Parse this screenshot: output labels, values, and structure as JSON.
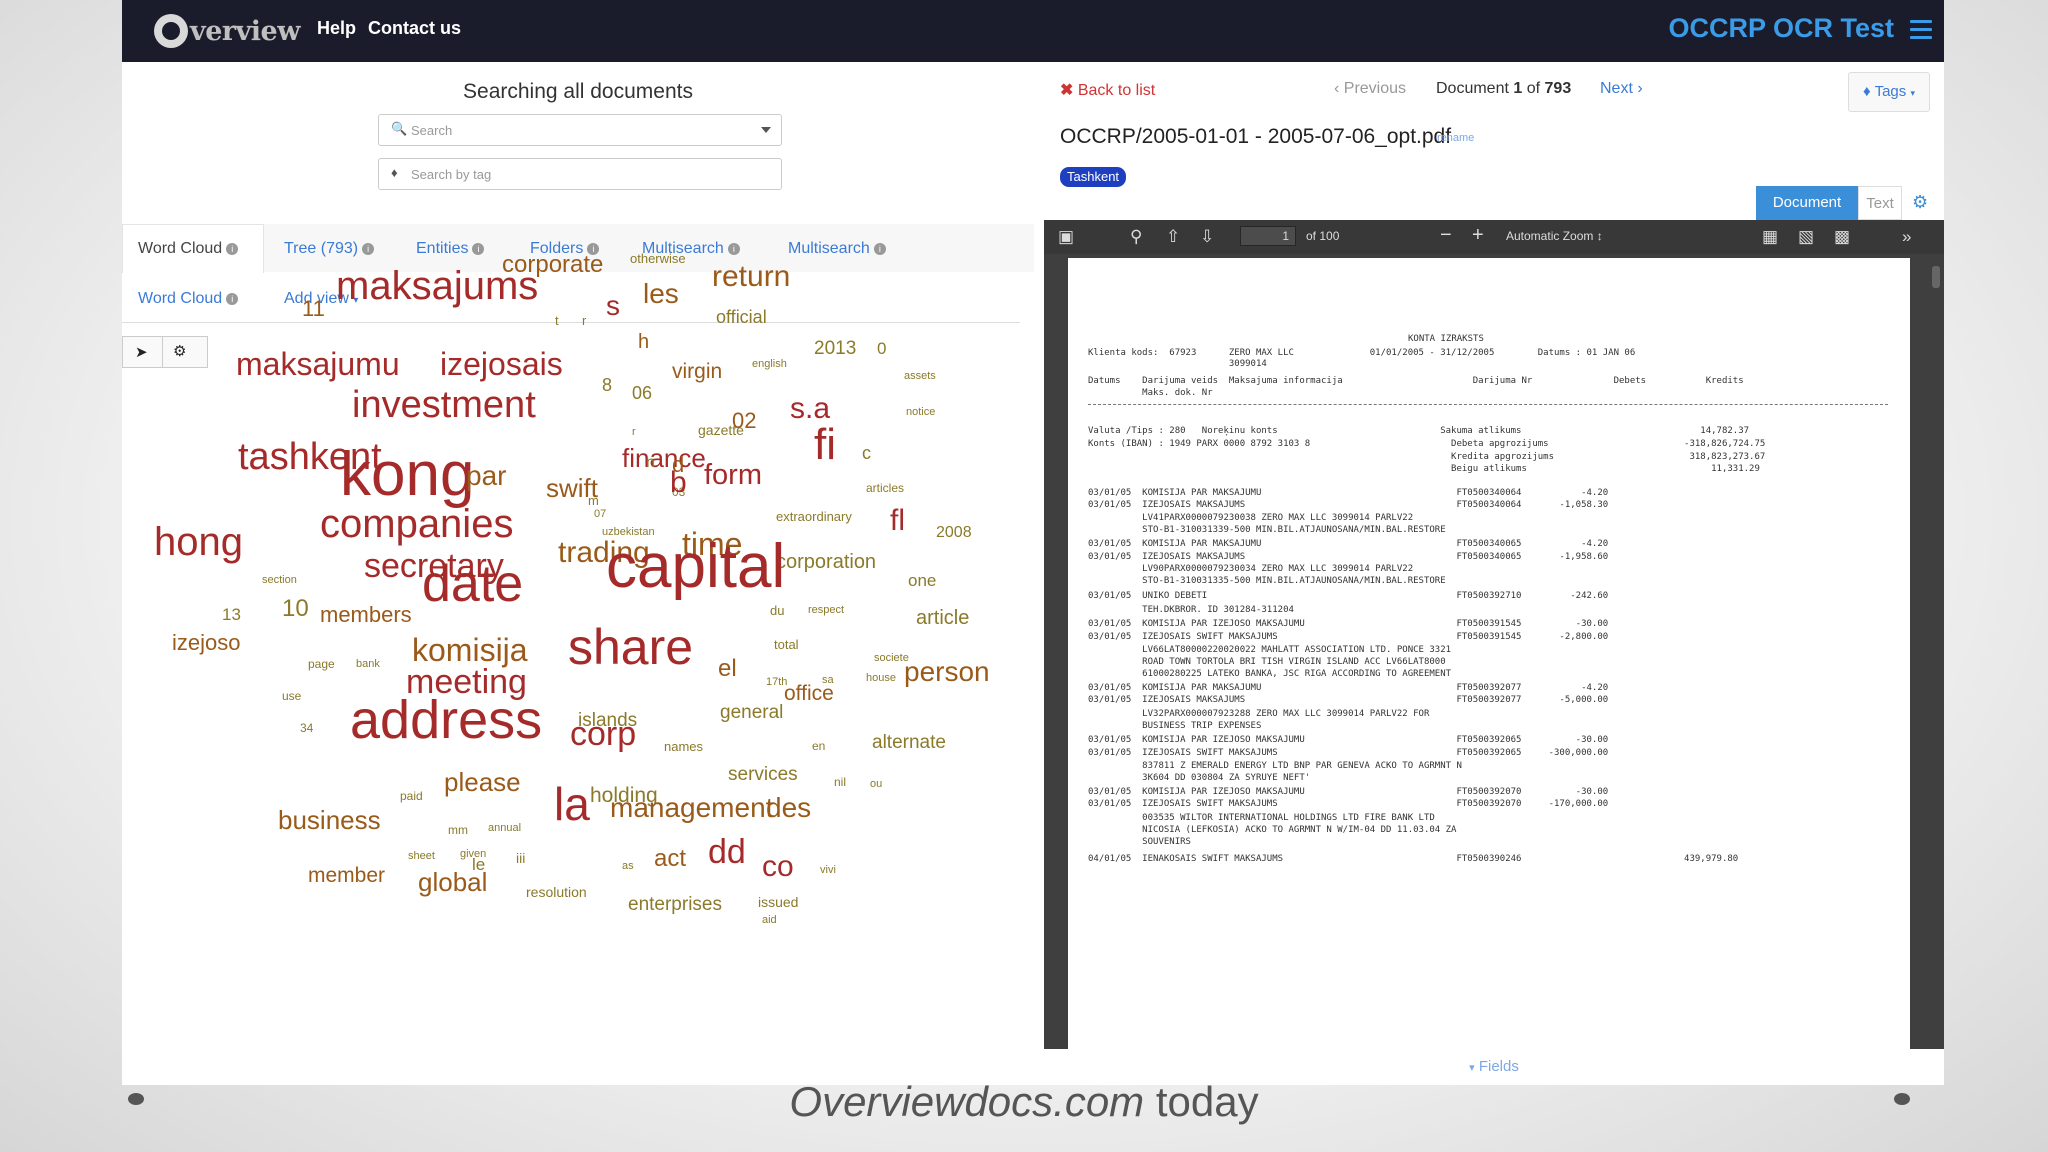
{
  "navbar": {
    "logo_text": "verview",
    "links": [
      "Help",
      "Contact us"
    ],
    "app_title": "OCCRP OCR Test",
    "menu_icon": "hamburger-icon"
  },
  "search": {
    "heading": "Searching all documents",
    "search_placeholder": "Search",
    "tag_placeholder": "Search by tag"
  },
  "views": {
    "tabs_row1": [
      {
        "label": "Word Cloud",
        "active": true
      },
      {
        "label": "Tree (793)",
        "active": false
      },
      {
        "label": "Entities",
        "active": false
      },
      {
        "label": "Folders",
        "active": false
      },
      {
        "label": "Multisearch",
        "active": false
      },
      {
        "label": "Multisearch",
        "active": false
      }
    ],
    "tabs_row2": [
      {
        "label": "Word Cloud"
      },
      {
        "label": "Add view"
      }
    ]
  },
  "word_cloud": {
    "colors": {
      "dark": "#a52a2a",
      "mid": "#9a5a1a",
      "light": "#8a7a2a"
    },
    "words": [
      "corporate",
      "otherwise",
      "return",
      "11",
      "maksajums",
      "t",
      "r",
      "les",
      "s",
      "official",
      "h",
      "maksajumu",
      "izejosais",
      "virgin",
      "english",
      "2013",
      "0",
      "assets",
      "investment",
      "8",
      "06",
      "r",
      "gazette",
      "02",
      "s.a",
      "notice",
      "finance",
      "n",
      "d",
      "03",
      "c",
      "tashkent",
      "kong",
      "par",
      "swift",
      "m",
      "uzbekistan",
      "b",
      "form",
      "fi",
      "articles",
      "07",
      "extraordinary",
      "fl",
      "2008",
      "hong",
      "companies",
      "trading",
      "time",
      "corporation",
      "section",
      "one",
      "secretary",
      "13",
      "10",
      "members",
      "date",
      "capital",
      "du",
      "respect",
      "article",
      "izejoso",
      "total",
      "societe",
      "page",
      "bank",
      "komisija",
      "sa",
      "house",
      "share",
      "el",
      "17th",
      "use",
      "meeting",
      "office",
      "person",
      "34",
      "islands",
      "general",
      "address",
      "names",
      "corp",
      "en",
      "alternate",
      "services",
      "nil",
      "ou",
      "paid",
      "please",
      "holding",
      "business",
      "mm",
      "annual",
      "la",
      "management",
      "des",
      "given",
      "sheet",
      "le",
      "iii",
      "as",
      "act",
      "dd",
      "co",
      "vivi",
      "member",
      "global",
      "resolution",
      "issued",
      "enterprises",
      "aid"
    ]
  },
  "document": {
    "back_label": "Back to list",
    "prev_label": "Previous",
    "position_prefix": "Document",
    "position_current": "1",
    "position_of": "of",
    "position_total": "793",
    "next_label": "Next",
    "tags_label": "Tags",
    "title": "OCCRP/2005-01-01 - 2005-07-06_opt.pdf",
    "rename_label": "rename",
    "tag_badge": "Tashkent",
    "view_tabs": [
      "Document",
      "Text"
    ],
    "pdf_toolbar": {
      "page_value": "1",
      "page_count": "of 100",
      "zoom": "Automatic Zoom"
    },
    "fields_label": "Fields",
    "statement_text": [
      "KONTA IZRAKSTS",
      "Klienta kods:  67923      ZERO MAX LLC              01/01/2005 - 31/12/2005        Datums : 01 JAN 06",
      "                          3099014",
      "Datums    Darijuma veids  Maksajuma informacija                        Darijuma Nr               Debets           Kredits",
      "          Maks. dok. Nr",
      "Valuta /Tips : 280   Noreķinu konts                              Sakuma atlikums                                 14,782.37",
      "Konts (IBAN) : 1949 PARX 0000 8792 3103 8                          Debeta apgrozijums                         -318,826,724.75",
      "                                                                   Kredita apgrozijums                         318,823,273.67",
      "                                                                   Beigu atlikums                                  11,331.29",
      "03/01/05  KOMISIJA PAR MAKSAJUMU                                    FT0500340064           -4.20",
      "03/01/05  IZEJOSAIS MAKSAJUMS                                       FT0500340064       -1,058.30",
      "          LV41PARX0000079230038 ZERO MAX LLC 3099014 PARLV22",
      "          STO-B1-310031339-500 MIN.BIL.ATJAUNOSANA/MIN.BAL.RESTORE",
      "03/01/05  KOMISIJA PAR MAKSAJUMU                                    FT0500340065           -4.20",
      "03/01/05  IZEJOSAIS MAKSAJUMS                                       FT0500340065       -1,958.60",
      "          LV90PARX0000079230034 ZERO MAX LLC 3099014 PARLV22",
      "          STO-B1-310031335-500 MIN.BIL.ATJAUNOSANA/MIN.BAL.RESTORE",
      "03/01/05  UNIKO DEBETI                                              FT0500392710         -242.60",
      "          TEH.DKBROR. ID 301284-311204",
      "03/01/05  KOMISIJA PAR IZEJOSO MAKSAJUMU                            FT0500391545          -30.00",
      "03/01/05  IZEJOSAIS SWIFT MAKSAJUMS                                 FT0500391545       -2,800.00",
      "          LV66LAT80000220020022 MAHLATT ASSOCIATION LTD. PONCE 3321",
      "          ROAD TOWN TORTOLA BRI TISH VIRGIN ISLAND ACC LV66LAT8000",
      "          61000280225 LATEKO BANKA, JSC RIGA ACCORDING TO AGREEMENT",
      "03/01/05  KOMISIJA PAR MAKSAJUMU                                    FT0500392077           -4.20",
      "03/01/05  IZEJOSAIS MAKSAJUMS                                       FT0500392077       -5,000.00",
      "          LV32PARX000007923288 ZERO MAX LLC 3099014 PARLV22 FOR",
      "          BUSINESS TRIP EXPENSES",
      "03/01/05  KOMISIJA PAR IZEJOSO MAKSAJUMU                            FT0500392065          -30.00",
      "03/01/05  IZEJOSAIS SWIFT MAKSAJUMS                                 FT0500392065     -300,000.00",
      "          837811 Z EMERALD ENERGY LTD BNP PAR GENEVA ACKO TO AGRMNT N",
      "          3K604 DD 030804 ZA SYRUYE NEFT'",
      "03/01/05  KOMISIJA PAR IZEJOSO MAKSAJUMU                            FT0500392070          -30.00",
      "03/01/05  IZEJOSAIS SWIFT MAKSAJUMS                                 FT0500392070     -170,000.00",
      "          003535 WILTOR INTERNATIONAL HOLDINGS LTD FIRE BANK LTD",
      "          NICOSIA (LEFKOSIA) ACKO TO AGRMNT N W/IM-04 DD 11.03.04 ZA",
      "          SOUVENIRS",
      "04/01/05  IENAKOSAIS SWIFT MAKSAJUMS                                FT0500390246                              439,979.80"
    ]
  },
  "caption": {
    "italic": "Overviewdocs.com",
    "rest": " today"
  }
}
